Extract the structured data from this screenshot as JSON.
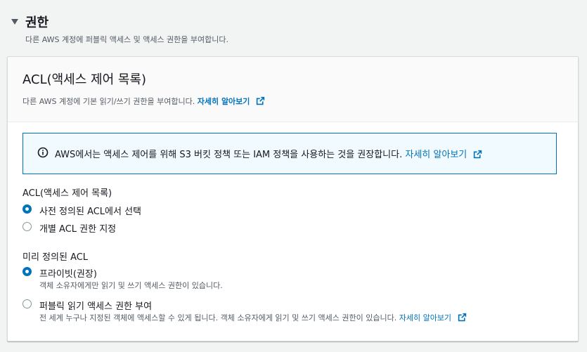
{
  "section": {
    "title": "권한",
    "description": "다른 AWS 계정에 퍼블릭 액세스 및 액세스 권한을 부여합니다."
  },
  "panel": {
    "title": "ACL(액세스 제어 목록)",
    "description": "다른 AWS 계정에 기본 읽기/쓰기 권한을 부여합니다.",
    "learn_more": "자세히 알아보기"
  },
  "alert": {
    "text": "AWS에서는 액세스 제어를 위해 S3 버킷 정책 또는 IAM 정책을 사용하는 것을 권장합니다.",
    "learn_more": "자세히 알아보기"
  },
  "acl_mode": {
    "label": "ACL(액세스 제어 목록)",
    "options": [
      {
        "label": "사전 정의된 ACL에서 선택",
        "checked": true
      },
      {
        "label": "개별 ACL 권한 지정",
        "checked": false
      }
    ]
  },
  "predefined_acl": {
    "label": "미리 정의된 ACL",
    "options": [
      {
        "label": "프라이빗(권장)",
        "description": "객체 소유자에게만 읽기 및 쓰기 액세스 권한이 있습니다.",
        "checked": true
      },
      {
        "label": "퍼블릭 읽기 액세스 권한 부여",
        "description": "전 세계 누구나 지정된 객체에 액세스할 수 있게 됩니다. 객체 소유자에게 읽기 및 쓰기 액세스 권한이 있습니다.",
        "learn_more": "자세히 알아보기",
        "checked": false
      }
    ]
  },
  "colors": {
    "accent": "#0073bb",
    "background": "#f2f3f3",
    "text": "#16191f",
    "muted": "#545b64"
  }
}
